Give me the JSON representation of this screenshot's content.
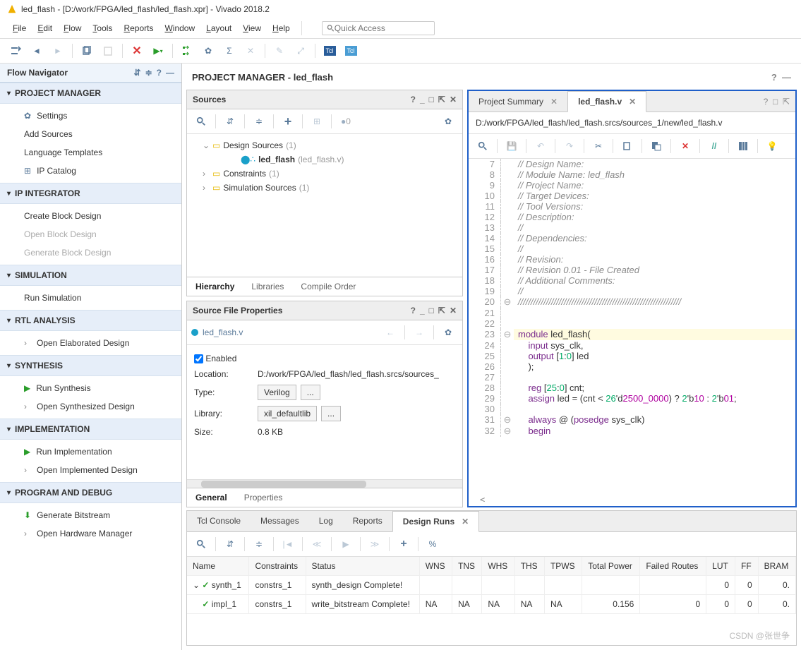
{
  "title": "led_flash - [D:/work/FPGA/led_flash/led_flash.xpr] - Vivado 2018.2",
  "menus": [
    "File",
    "Edit",
    "Flow",
    "Tools",
    "Reports",
    "Window",
    "Layout",
    "View",
    "Help"
  ],
  "quick_placeholder": "Quick Access",
  "flow_nav_title": "Flow Navigator",
  "nav": [
    {
      "title": "PROJECT MANAGER",
      "items": [
        {
          "label": "Settings",
          "icon": "gear"
        },
        {
          "label": "Add Sources"
        },
        {
          "label": "Language Templates"
        },
        {
          "label": "IP Catalog",
          "icon": "ip"
        }
      ]
    },
    {
      "title": "IP INTEGRATOR",
      "items": [
        {
          "label": "Create Block Design"
        },
        {
          "label": "Open Block Design",
          "muted": true
        },
        {
          "label": "Generate Block Design",
          "muted": true
        }
      ]
    },
    {
      "title": "SIMULATION",
      "items": [
        {
          "label": "Run Simulation"
        }
      ]
    },
    {
      "title": "RTL ANALYSIS",
      "items": [
        {
          "label": "Open Elaborated Design",
          "chev": true
        }
      ]
    },
    {
      "title": "SYNTHESIS",
      "items": [
        {
          "label": "Run Synthesis",
          "icon": "play-green"
        },
        {
          "label": "Open Synthesized Design",
          "chev": true
        }
      ]
    },
    {
      "title": "IMPLEMENTATION",
      "items": [
        {
          "label": "Run Implementation",
          "icon": "play-green"
        },
        {
          "label": "Open Implemented Design",
          "chev": true
        }
      ]
    },
    {
      "title": "PROGRAM AND DEBUG",
      "items": [
        {
          "label": "Generate Bitstream",
          "icon": "bitstream"
        },
        {
          "label": "Open Hardware Manager",
          "chev": true
        }
      ]
    }
  ],
  "pm_title": "PROJECT MANAGER - led_flash",
  "sources": {
    "title": "Sources",
    "count": "0",
    "tree": [
      {
        "l": 1,
        "arr": "v",
        "text": "Design Sources",
        "suffix": "(1)",
        "icon": "folder"
      },
      {
        "l": 3,
        "text": "led_flash",
        "suffix": "(led_flash.v)",
        "icon": "module",
        "top": true
      },
      {
        "l": 1,
        "arr": ">",
        "text": "Constraints",
        "suffix": "(1)",
        "icon": "folder"
      },
      {
        "l": 1,
        "arr": ">",
        "text": "Simulation Sources",
        "suffix": "(1)",
        "icon": "folder"
      }
    ],
    "tabs": [
      "Hierarchy",
      "Libraries",
      "Compile Order"
    ],
    "active_tab": 0
  },
  "props": {
    "title": "Source File Properties",
    "file": "led_flash.v",
    "enabled_label": "Enabled",
    "rows": {
      "location_lbl": "Location:",
      "location_val": "D:/work/FPGA/led_flash/led_flash.srcs/sources_",
      "type_lbl": "Type:",
      "type_val": "Verilog",
      "lib_lbl": "Library:",
      "lib_val": "xil_defaultlib",
      "size_lbl": "Size:",
      "size_val": "0.8 KB"
    },
    "tabs": [
      "General",
      "Properties"
    ],
    "active_tab": 0
  },
  "editor": {
    "tabs": [
      {
        "label": "Project Summary",
        "active": false,
        "closable": true
      },
      {
        "label": "led_flash.v",
        "active": true,
        "closable": true
      }
    ],
    "path": "D:/work/FPGA/led_flash/led_flash.srcs/sources_1/new/led_flash.v",
    "lines": [
      {
        "n": 7,
        "c": "// Design Name:",
        "cls": "comment"
      },
      {
        "n": 8,
        "c": "// Module Name: led_flash",
        "cls": "comment"
      },
      {
        "n": 9,
        "c": "// Project Name:",
        "cls": "comment"
      },
      {
        "n": 10,
        "c": "// Target Devices:",
        "cls": "comment"
      },
      {
        "n": 11,
        "c": "// Tool Versions:",
        "cls": "comment"
      },
      {
        "n": 12,
        "c": "// Description:",
        "cls": "comment"
      },
      {
        "n": 13,
        "c": "//",
        "cls": "comment"
      },
      {
        "n": 14,
        "c": "// Dependencies:",
        "cls": "comment"
      },
      {
        "n": 15,
        "c": "//",
        "cls": "comment"
      },
      {
        "n": 16,
        "c": "// Revision:",
        "cls": "comment"
      },
      {
        "n": 17,
        "c": "// Revision 0.01 - File Created",
        "cls": "comment"
      },
      {
        "n": 18,
        "c": "// Additional Comments:",
        "cls": "comment"
      },
      {
        "n": 19,
        "c": "//",
        "cls": "comment"
      },
      {
        "n": 20,
        "c": "////////////////////////////////////////////////////////////////",
        "cls": "comment",
        "fold": "⊖"
      },
      {
        "n": 21,
        "c": ""
      },
      {
        "n": 22,
        "c": ""
      },
      {
        "n": 23,
        "c": "module led_flash(",
        "hl": true,
        "fold": "⊖",
        "parts": [
          [
            "kw",
            "module "
          ],
          [
            "",
            "led_flash("
          ]
        ]
      },
      {
        "n": 24,
        "c": "    input sys_clk,",
        "parts": [
          [
            "",
            "    "
          ],
          [
            "kw",
            "input"
          ],
          [
            "",
            " sys_clk,"
          ]
        ]
      },
      {
        "n": 25,
        "c": "    output [1:0] led",
        "parts": [
          [
            "",
            "    "
          ],
          [
            "kw",
            "output"
          ],
          [
            "",
            " ["
          ],
          [
            "num",
            "1"
          ],
          [
            "",
            ":"
          ],
          [
            "num",
            "0"
          ],
          [
            "",
            "] led"
          ]
        ]
      },
      {
        "n": 26,
        "c": "    );"
      },
      {
        "n": 27,
        "c": ""
      },
      {
        "n": 28,
        "c": "    reg [25:0] cnt;",
        "parts": [
          [
            "",
            "    "
          ],
          [
            "kw",
            "reg"
          ],
          [
            "",
            " ["
          ],
          [
            "num",
            "25"
          ],
          [
            "",
            ":"
          ],
          [
            "num",
            "0"
          ],
          [
            "",
            "] cnt;"
          ]
        ]
      },
      {
        "n": 29,
        "c": "    assign led = (cnt < 26'd2500_0000) ? 2'b10 : 2'b01;",
        "parts": [
          [
            "",
            "    "
          ],
          [
            "kw",
            "assign"
          ],
          [
            "",
            " led = (cnt < "
          ],
          [
            "num",
            "26"
          ],
          [
            "",
            "'d"
          ],
          [
            "lit",
            "2500_0000"
          ],
          [
            "",
            ") ? "
          ],
          [
            "num",
            "2"
          ],
          [
            "",
            "'b"
          ],
          [
            "lit",
            "10"
          ],
          [
            "",
            " : "
          ],
          [
            "num",
            "2"
          ],
          [
            "",
            "'b"
          ],
          [
            "lit",
            "01"
          ],
          [
            "",
            ";"
          ]
        ]
      },
      {
        "n": 30,
        "c": ""
      },
      {
        "n": 31,
        "c": "    always @ (posedge sys_clk)",
        "fold": "⊖",
        "parts": [
          [
            "",
            "    "
          ],
          [
            "kw",
            "always"
          ],
          [
            "",
            " @ ("
          ],
          [
            "kw",
            "posedge"
          ],
          [
            "",
            " sys_clk)"
          ]
        ]
      },
      {
        "n": 32,
        "c": "    begin",
        "fold": "⊖",
        "parts": [
          [
            "",
            "    "
          ],
          [
            "kw",
            "begin"
          ]
        ]
      }
    ]
  },
  "runs": {
    "tabs": [
      "Tcl Console",
      "Messages",
      "Log",
      "Reports",
      "Design Runs"
    ],
    "active_tab": 4,
    "cols": [
      "Name",
      "Constraints",
      "Status",
      "WNS",
      "TNS",
      "WHS",
      "THS",
      "TPWS",
      "Total Power",
      "Failed Routes",
      "LUT",
      "FF",
      "BRAM"
    ],
    "rows": [
      {
        "name": "synth_1",
        "indent": 0,
        "status": "synth_design Complete!",
        "constraints": "constrs_1",
        "wns": "",
        "tns": "",
        "whs": "",
        "ths": "",
        "tpws": "",
        "power": "",
        "failed": "",
        "lut": "0",
        "ff": "0",
        "bram": "0."
      },
      {
        "name": "impl_1",
        "indent": 1,
        "status": "write_bitstream Complete!",
        "constraints": "constrs_1",
        "wns": "NA",
        "tns": "NA",
        "whs": "NA",
        "ths": "NA",
        "tpws": "NA",
        "power": "0.156",
        "failed": "0",
        "lut": "0",
        "ff": "0",
        "bram": "0."
      }
    ]
  },
  "watermark": "CSDN @张世争"
}
